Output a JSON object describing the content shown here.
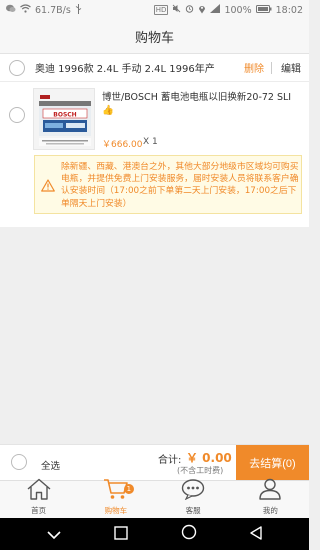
{
  "status_bar": {
    "speed": "61.7B/s",
    "hd_badge": "HD",
    "battery": "100%",
    "time": "18:02",
    "icons": [
      "wechat-icon",
      "wifi-icon",
      "usb-icon",
      "mute-icon",
      "alarm-icon",
      "location-icon",
      "signal-icon",
      "battery-icon"
    ]
  },
  "header": {
    "title": "购物车"
  },
  "shop": {
    "name": "奥迪 1996款 2.4L 手动 2.4L 1996年产",
    "delete_label": "删除",
    "edit_label": "编辑"
  },
  "item": {
    "name": "博世/BOSCH 蓄电池电瓶以旧换新20-72 SLI",
    "like_emoji": "👍",
    "price": "￥666.00",
    "qty": "X 1",
    "thumb_brand": "BOSCH"
  },
  "notice": {
    "icon": "warning-icon",
    "text": "除新疆、西藏、港澳台之外，其他大部分地级市区域均可购买电瓶，并提供免费上门安装服务，届时安装人员将联系客户确认安装时间（17:00之前下单第二天上门安装，17:00之后下单隔天上门安装）"
  },
  "bottom": {
    "select_all": "全选",
    "total_label": "合计:",
    "total_value": "￥ 0.00",
    "fee_note": "(不含工时费)",
    "checkout_label": "去结算(0)"
  },
  "tabs": [
    {
      "label": "首页",
      "icon": "home-icon"
    },
    {
      "label": "购物车",
      "icon": "cart-icon",
      "badge": "1"
    },
    {
      "label": "客服",
      "icon": "chat-icon"
    },
    {
      "label": "我的",
      "icon": "user-icon"
    }
  ],
  "colors": {
    "accent": "#f08a2a",
    "background": "#efefef",
    "notice_bg": "#fffbe5"
  }
}
